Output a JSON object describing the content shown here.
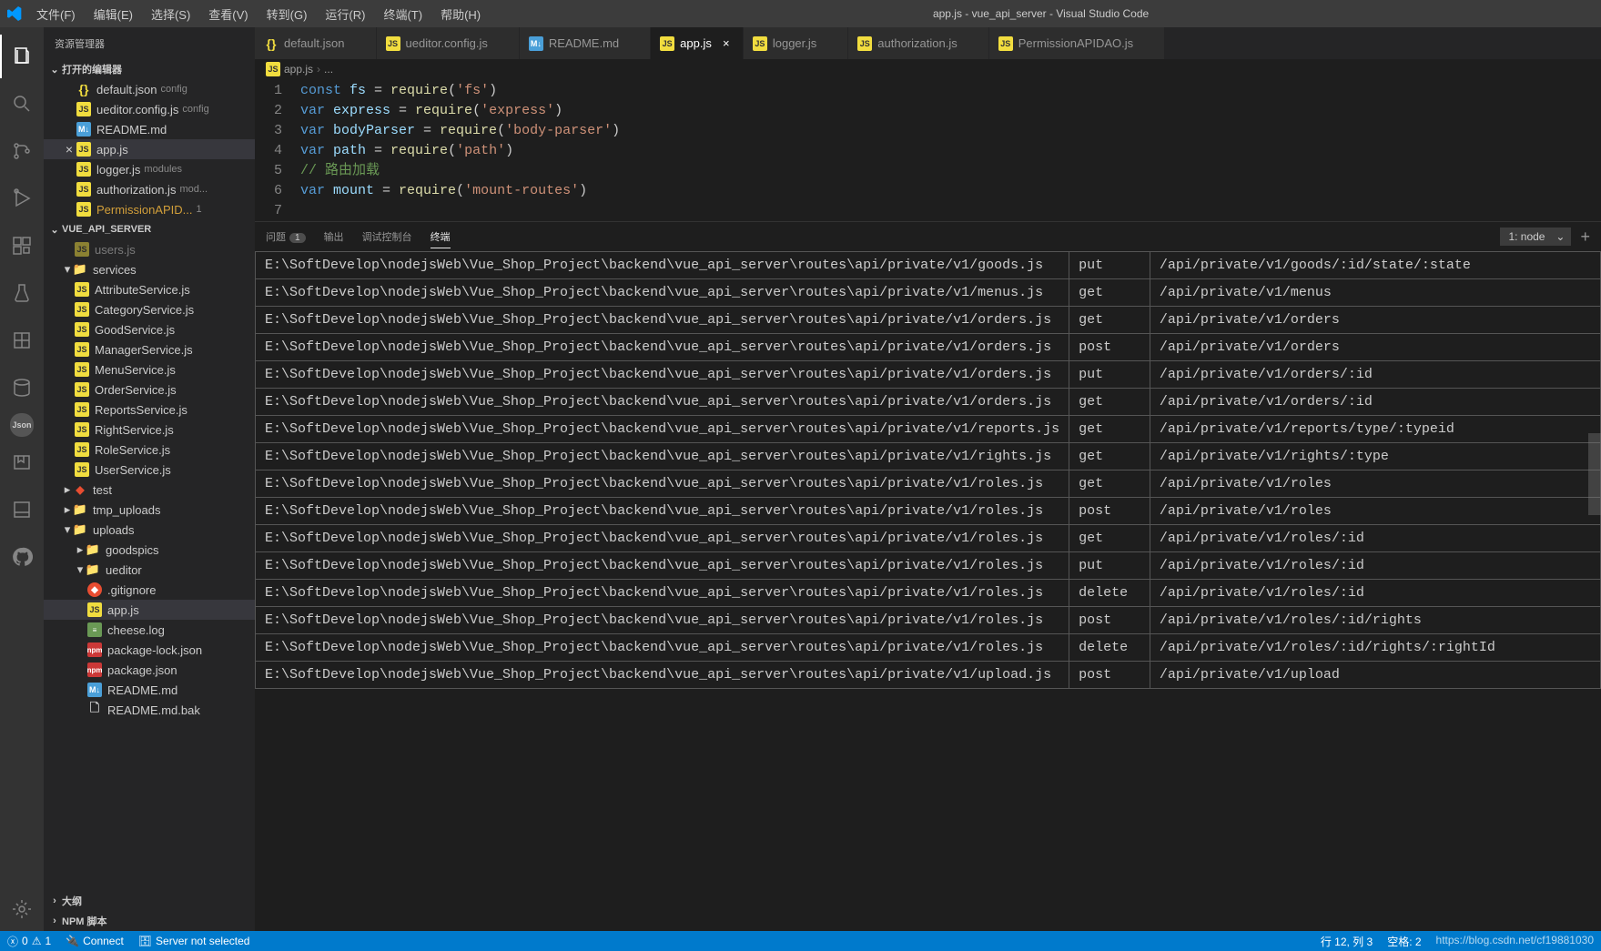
{
  "window": {
    "title": "app.js - vue_api_server - Visual Studio Code"
  },
  "menu": [
    "文件(F)",
    "编辑(E)",
    "选择(S)",
    "查看(V)",
    "转到(G)",
    "运行(R)",
    "终端(T)",
    "帮助(H)"
  ],
  "sidebar": {
    "title": "资源管理器",
    "sections": {
      "openEditors": {
        "label": "打开的编辑器"
      },
      "project": {
        "label": "VUE_API_SERVER"
      },
      "outline": {
        "label": "大纲"
      },
      "npm": {
        "label": "NPM 脚本"
      }
    },
    "openEditors": [
      {
        "icon": "json",
        "name": "default.json",
        "desc": "config"
      },
      {
        "icon": "js",
        "name": "ueditor.config.js",
        "desc": "config"
      },
      {
        "icon": "md",
        "name": "README.md",
        "desc": ""
      },
      {
        "icon": "js",
        "name": "app.js",
        "desc": "",
        "active": true
      },
      {
        "icon": "js",
        "name": "logger.js",
        "desc": "modules"
      },
      {
        "icon": "js",
        "name": "authorization.js",
        "desc": "mod..."
      },
      {
        "icon": "js",
        "name": "PermissionAPID...",
        "desc": "1",
        "warn": true
      }
    ],
    "tree": [
      {
        "indent": 1,
        "icon": "js",
        "name": "users.js",
        "dim": true
      },
      {
        "indent": 0,
        "chev": "▾",
        "icon": "folder",
        "name": "services"
      },
      {
        "indent": 1,
        "icon": "js",
        "name": "AttributeService.js"
      },
      {
        "indent": 1,
        "icon": "js",
        "name": "CategoryService.js"
      },
      {
        "indent": 1,
        "icon": "js",
        "name": "GoodService.js"
      },
      {
        "indent": 1,
        "icon": "js",
        "name": "ManagerService.js"
      },
      {
        "indent": 1,
        "icon": "js",
        "name": "MenuService.js"
      },
      {
        "indent": 1,
        "icon": "js",
        "name": "OrderService.js"
      },
      {
        "indent": 1,
        "icon": "js",
        "name": "ReportsService.js"
      },
      {
        "indent": 1,
        "icon": "js",
        "name": "RightService.js"
      },
      {
        "indent": 1,
        "icon": "js",
        "name": "RoleService.js"
      },
      {
        "indent": 1,
        "icon": "js",
        "name": "UserService.js"
      },
      {
        "indent": 0,
        "chev": "▸",
        "icon": "m",
        "name": "test"
      },
      {
        "indent": 0,
        "chev": "▸",
        "icon": "folder",
        "name": "tmp_uploads"
      },
      {
        "indent": 0,
        "chev": "▾",
        "icon": "folder",
        "name": "uploads"
      },
      {
        "indent": 1,
        "chev": "▸",
        "icon": "folder",
        "name": "goodspics"
      },
      {
        "indent": 1,
        "chev": "▾",
        "icon": "folder",
        "name": "ueditor"
      },
      {
        "indent": 2,
        "icon": "git",
        "name": ".gitignore"
      },
      {
        "indent": 2,
        "icon": "js",
        "name": "app.js",
        "selected": true
      },
      {
        "indent": 2,
        "icon": "log",
        "name": "cheese.log"
      },
      {
        "indent": 2,
        "icon": "npm",
        "name": "package-lock.json"
      },
      {
        "indent": 2,
        "icon": "npm",
        "name": "package.json"
      },
      {
        "indent": 2,
        "icon": "md",
        "name": "README.md"
      },
      {
        "indent": 2,
        "icon": "file",
        "name": "README.md.bak"
      }
    ]
  },
  "tabs": [
    {
      "icon": "json",
      "label": "default.json"
    },
    {
      "icon": "js",
      "label": "ueditor.config.js"
    },
    {
      "icon": "md",
      "label": "README.md"
    },
    {
      "icon": "js",
      "label": "app.js",
      "active": true
    },
    {
      "icon": "js",
      "label": "logger.js"
    },
    {
      "icon": "js",
      "label": "authorization.js"
    },
    {
      "icon": "js",
      "label": "PermissionAPIDAO.js"
    }
  ],
  "breadcrumb": {
    "file": "app.js",
    "rest": "..."
  },
  "code": {
    "lines": [
      [
        {
          "t": "const ",
          "c": "kw"
        },
        {
          "t": "fs",
          "c": "var"
        },
        {
          "t": " = "
        },
        {
          "t": "require",
          "c": "fn"
        },
        {
          "t": "("
        },
        {
          "t": "'fs'",
          "c": "str"
        },
        {
          "t": ")"
        }
      ],
      [
        {
          "t": "var ",
          "c": "kw"
        },
        {
          "t": "express",
          "c": "var"
        },
        {
          "t": " = "
        },
        {
          "t": "require",
          "c": "fn"
        },
        {
          "t": "("
        },
        {
          "t": "'express'",
          "c": "str"
        },
        {
          "t": ")"
        }
      ],
      [
        {
          "t": "var ",
          "c": "kw"
        },
        {
          "t": "bodyParser",
          "c": "var"
        },
        {
          "t": " = "
        },
        {
          "t": "require",
          "c": "fn"
        },
        {
          "t": "("
        },
        {
          "t": "'body-parser'",
          "c": "str"
        },
        {
          "t": ")"
        }
      ],
      [
        {
          "t": "var ",
          "c": "kw"
        },
        {
          "t": "path",
          "c": "var"
        },
        {
          "t": " = "
        },
        {
          "t": "require",
          "c": "fn"
        },
        {
          "t": "("
        },
        {
          "t": "'path'",
          "c": "str"
        },
        {
          "t": ")"
        }
      ],
      [
        {
          "t": "// 路由加载",
          "c": "cmt"
        }
      ],
      [
        {
          "t": "var ",
          "c": "kw"
        },
        {
          "t": "mount",
          "c": "var"
        },
        {
          "t": " = "
        },
        {
          "t": "require",
          "c": "fn"
        },
        {
          "t": "("
        },
        {
          "t": "'mount-routes'",
          "c": "str"
        },
        {
          "t": ")"
        }
      ],
      []
    ]
  },
  "panel": {
    "tabs": [
      {
        "label": "问题",
        "badge": "1"
      },
      {
        "label": "输出"
      },
      {
        "label": "调试控制台"
      },
      {
        "label": "终端",
        "active": true
      }
    ],
    "terminal": {
      "select": "1: node"
    },
    "routes": [
      [
        "E:\\SoftDevelop\\nodejsWeb\\Vue_Shop_Project\\backend\\vue_api_server\\routes\\api/private/v1/goods.js",
        "put",
        "/api/private/v1/goods/:id/state/:state"
      ],
      [
        "E:\\SoftDevelop\\nodejsWeb\\Vue_Shop_Project\\backend\\vue_api_server\\routes\\api/private/v1/menus.js",
        "get",
        "/api/private/v1/menus"
      ],
      [
        "E:\\SoftDevelop\\nodejsWeb\\Vue_Shop_Project\\backend\\vue_api_server\\routes\\api/private/v1/orders.js",
        "get",
        "/api/private/v1/orders"
      ],
      [
        "E:\\SoftDevelop\\nodejsWeb\\Vue_Shop_Project\\backend\\vue_api_server\\routes\\api/private/v1/orders.js",
        "post",
        "/api/private/v1/orders"
      ],
      [
        "E:\\SoftDevelop\\nodejsWeb\\Vue_Shop_Project\\backend\\vue_api_server\\routes\\api/private/v1/orders.js",
        "put",
        "/api/private/v1/orders/:id"
      ],
      [
        "E:\\SoftDevelop\\nodejsWeb\\Vue_Shop_Project\\backend\\vue_api_server\\routes\\api/private/v1/orders.js",
        "get",
        "/api/private/v1/orders/:id"
      ],
      [
        "E:\\SoftDevelop\\nodejsWeb\\Vue_Shop_Project\\backend\\vue_api_server\\routes\\api/private/v1/reports.js",
        "get",
        "/api/private/v1/reports/type/:typeid"
      ],
      [
        "E:\\SoftDevelop\\nodejsWeb\\Vue_Shop_Project\\backend\\vue_api_server\\routes\\api/private/v1/rights.js",
        "get",
        "/api/private/v1/rights/:type"
      ],
      [
        "E:\\SoftDevelop\\nodejsWeb\\Vue_Shop_Project\\backend\\vue_api_server\\routes\\api/private/v1/roles.js",
        "get",
        "/api/private/v1/roles"
      ],
      [
        "E:\\SoftDevelop\\nodejsWeb\\Vue_Shop_Project\\backend\\vue_api_server\\routes\\api/private/v1/roles.js",
        "post",
        "/api/private/v1/roles"
      ],
      [
        "E:\\SoftDevelop\\nodejsWeb\\Vue_Shop_Project\\backend\\vue_api_server\\routes\\api/private/v1/roles.js",
        "get",
        "/api/private/v1/roles/:id"
      ],
      [
        "E:\\SoftDevelop\\nodejsWeb\\Vue_Shop_Project\\backend\\vue_api_server\\routes\\api/private/v1/roles.js",
        "put",
        "/api/private/v1/roles/:id"
      ],
      [
        "E:\\SoftDevelop\\nodejsWeb\\Vue_Shop_Project\\backend\\vue_api_server\\routes\\api/private/v1/roles.js",
        "delete",
        "/api/private/v1/roles/:id"
      ],
      [
        "E:\\SoftDevelop\\nodejsWeb\\Vue_Shop_Project\\backend\\vue_api_server\\routes\\api/private/v1/roles.js",
        "post",
        "/api/private/v1/roles/:id/rights"
      ],
      [
        "E:\\SoftDevelop\\nodejsWeb\\Vue_Shop_Project\\backend\\vue_api_server\\routes\\api/private/v1/roles.js",
        "delete",
        "/api/private/v1/roles/:id/rights/:rightId"
      ],
      [
        "E:\\SoftDevelop\\nodejsWeb\\Vue_Shop_Project\\backend\\vue_api_server\\routes\\api/private/v1/upload.js",
        "post",
        "/api/private/v1/upload"
      ]
    ]
  },
  "status": {
    "errors": "0",
    "warnings": "1",
    "connect": "Connect",
    "server": "Server not selected",
    "ln": "行 12, 列 3",
    "spaces": "空格: 2",
    "watermark": "https://blog.csdn.net/cf19881030"
  }
}
